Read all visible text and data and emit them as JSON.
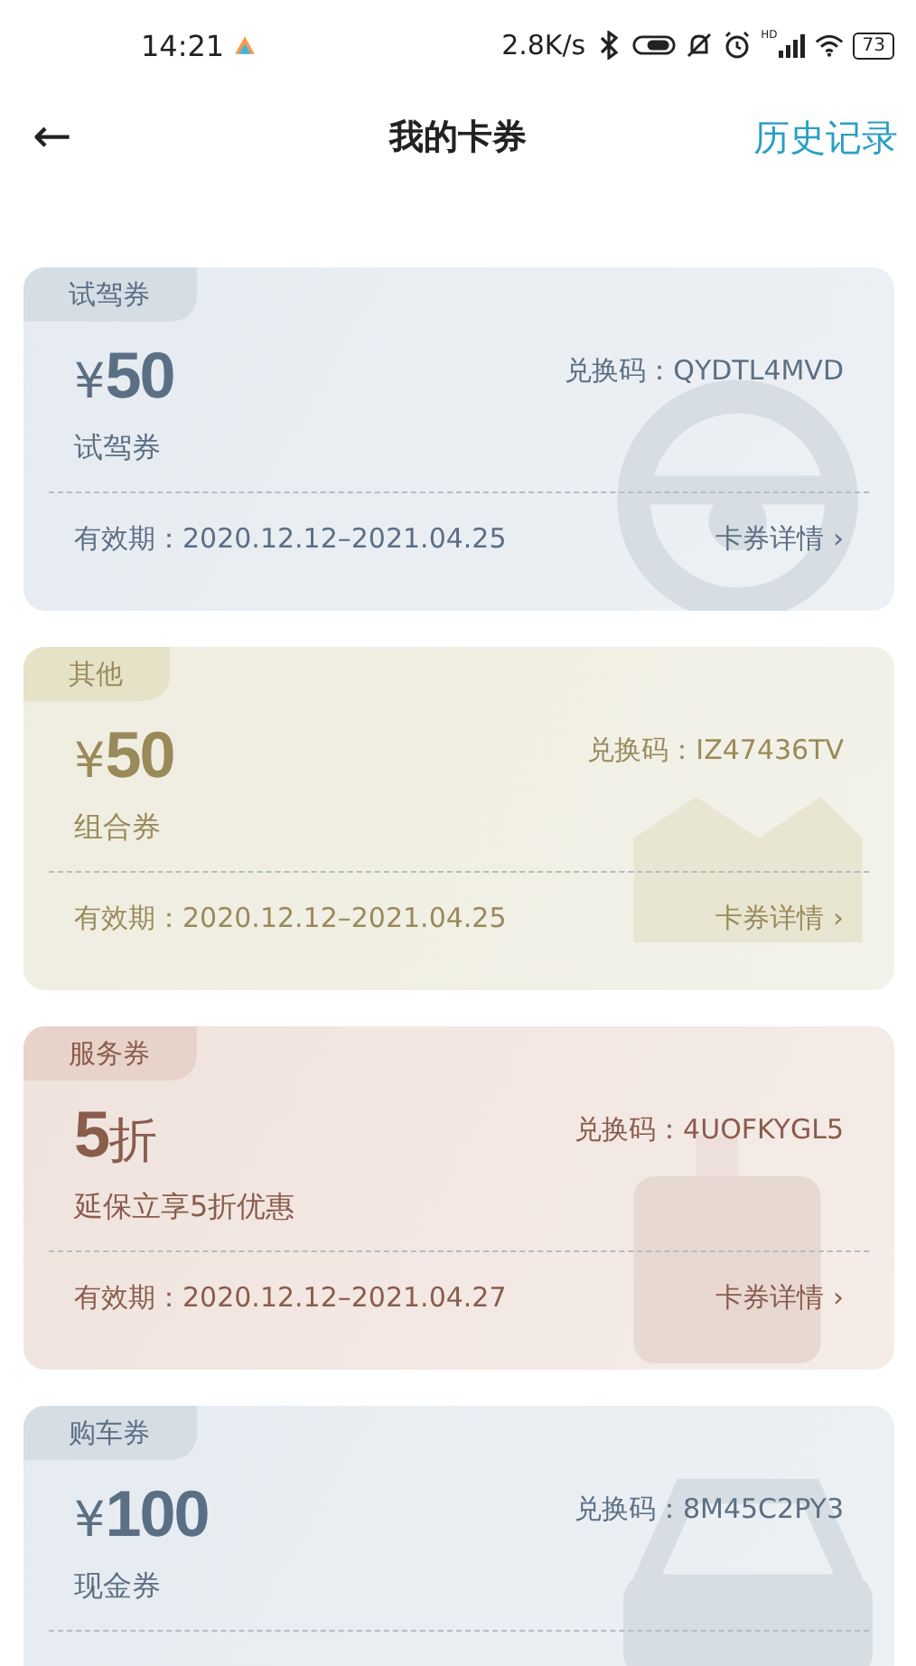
{
  "status_bar": {
    "time": "14:21",
    "net_speed": "2.8K/s",
    "hd_label": "HD",
    "battery": "73"
  },
  "header": {
    "back": "←",
    "title": "我的卡券",
    "history_link": "历史记录"
  },
  "coupons": [
    {
      "kind": "drive",
      "color": "#5b6f84",
      "tag": "试驾券",
      "value": "¥**50**",
      "name": "试驾券",
      "code": "兑换码：QYDTL4MVD",
      "validity": "有效期：2020.12.12–2021.04.25",
      "details": "卡券详情 ›"
    },
    {
      "kind": "other",
      "color": "#9a8a5a",
      "tag": "其他",
      "value": "¥**50**",
      "name": "组合券",
      "code": "兑换码：IZ47436TV",
      "validity": "有效期：2020.12.12–2021.04.25",
      "details": "卡券详情 ›"
    },
    {
      "kind": "service",
      "color": "#8a5c4c",
      "tag": "服务券",
      "value": "**5**折",
      "name": "延保立享5折优惠",
      "code": "兑换码：4UOFKYGL5",
      "validity": "有效期：2020.12.12–2021.04.27",
      "details": "卡券详情 ›"
    },
    {
      "kind": "purchase",
      "color": "#5b6f84",
      "tag": "购车券",
      "value": "¥**100**",
      "name": "现金券",
      "code": "兑换码：8M45C2PY3"
    }
  ]
}
